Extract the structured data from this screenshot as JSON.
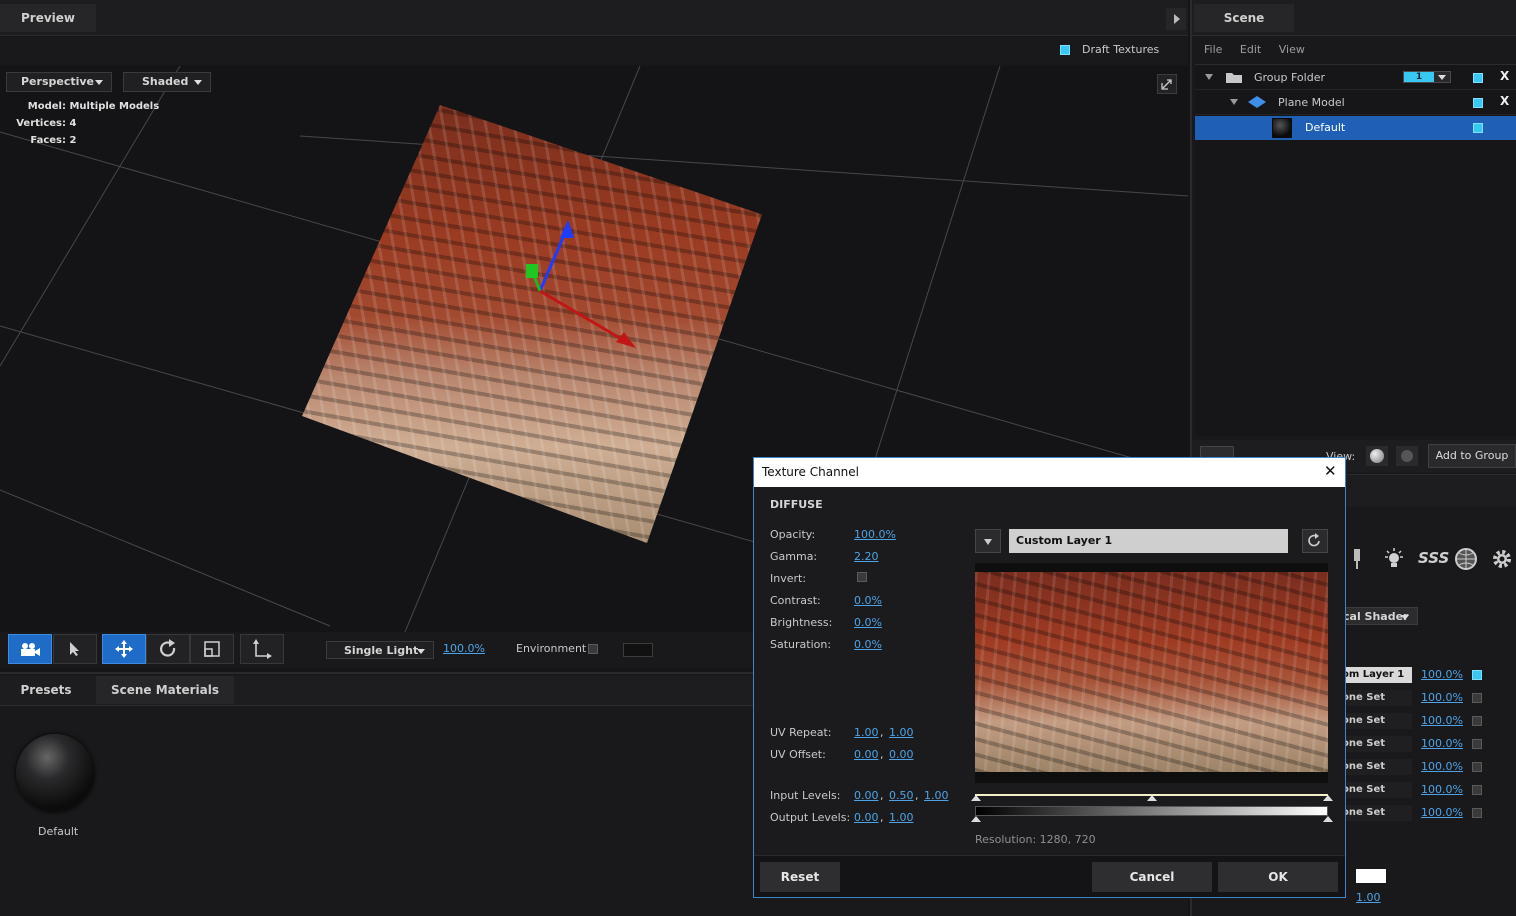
{
  "preview": {
    "tab_label": "Preview",
    "draft_textures_label": "Draft Textures",
    "view_mode": "Perspective",
    "shading_mode": "Shaded",
    "stats": {
      "model_label": "Model:",
      "model_value": "Multiple Models",
      "vertices_label": "Vertices:",
      "vertices_value": "4",
      "faces_label": "Faces:",
      "faces_value": "2"
    },
    "toolbar": {
      "light_mode": "Single Light",
      "light_percent": "100.0%",
      "environment_label": "Environment"
    }
  },
  "bottom_panel": {
    "tabs": [
      "Presets",
      "Scene Materials"
    ],
    "material_label": "Default"
  },
  "scene": {
    "tab_label": "Scene",
    "menu": [
      "File",
      "Edit",
      "View"
    ],
    "tree": [
      {
        "label": "Group Folder",
        "badge": "1",
        "close": "X"
      },
      {
        "label": "Plane Model",
        "close": "X"
      },
      {
        "label": "Default"
      }
    ],
    "view_label": "View:",
    "add_to_group_label": "Add to Group"
  },
  "properties": {
    "shader_label": "cal Shader",
    "sss_label": "SSS",
    "layers": [
      {
        "name": "om Layer 1",
        "value": "100.0%"
      },
      {
        "name": "one Set",
        "value": "100.0%"
      },
      {
        "name": "one Set",
        "value": "100.0%"
      },
      {
        "name": "one Set",
        "value": "100.0%"
      },
      {
        "name": "one Set",
        "value": "100.0%"
      },
      {
        "name": "one Set",
        "value": "100.0%"
      },
      {
        "name": "one Set",
        "value": "100.0%"
      }
    ],
    "bottom_value": "1.00"
  },
  "dialog": {
    "title": "Texture Channel",
    "close": "✕",
    "section": "DIFFUSE",
    "params": {
      "opacity_label": "Opacity:",
      "opacity": "100.0%",
      "gamma_label": "Gamma:",
      "gamma": "2.20",
      "invert_label": "Invert:",
      "contrast_label": "Contrast:",
      "contrast": "0.0%",
      "brightness_label": "Brightness:",
      "brightness": "0.0%",
      "saturation_label": "Saturation:",
      "saturation": "0.0%",
      "uv_repeat_label": "UV Repeat:",
      "uv_repeat_u": "1.00",
      "uv_repeat_v": "1.00",
      "uv_offset_label": "UV Offset:",
      "uv_offset_u": "0.00",
      "uv_offset_v": "0.00",
      "input_levels_label": "Input Levels:",
      "input_levels_low": "0.00",
      "input_levels_mid": "0.50",
      "input_levels_high": "1.00",
      "output_levels_label": "Output Levels:",
      "output_levels_low": "0.00",
      "output_levels_high": "1.00"
    },
    "layer_name": "Custom Layer 1",
    "resolution": "Resolution: 1280, 720",
    "reset_label": "Reset",
    "cancel_label": "Cancel",
    "ok_label": "OK"
  },
  "colors": {
    "accent": "#1e6cc7",
    "cyan": "#39c8f2",
    "link": "#4ea3e6"
  }
}
